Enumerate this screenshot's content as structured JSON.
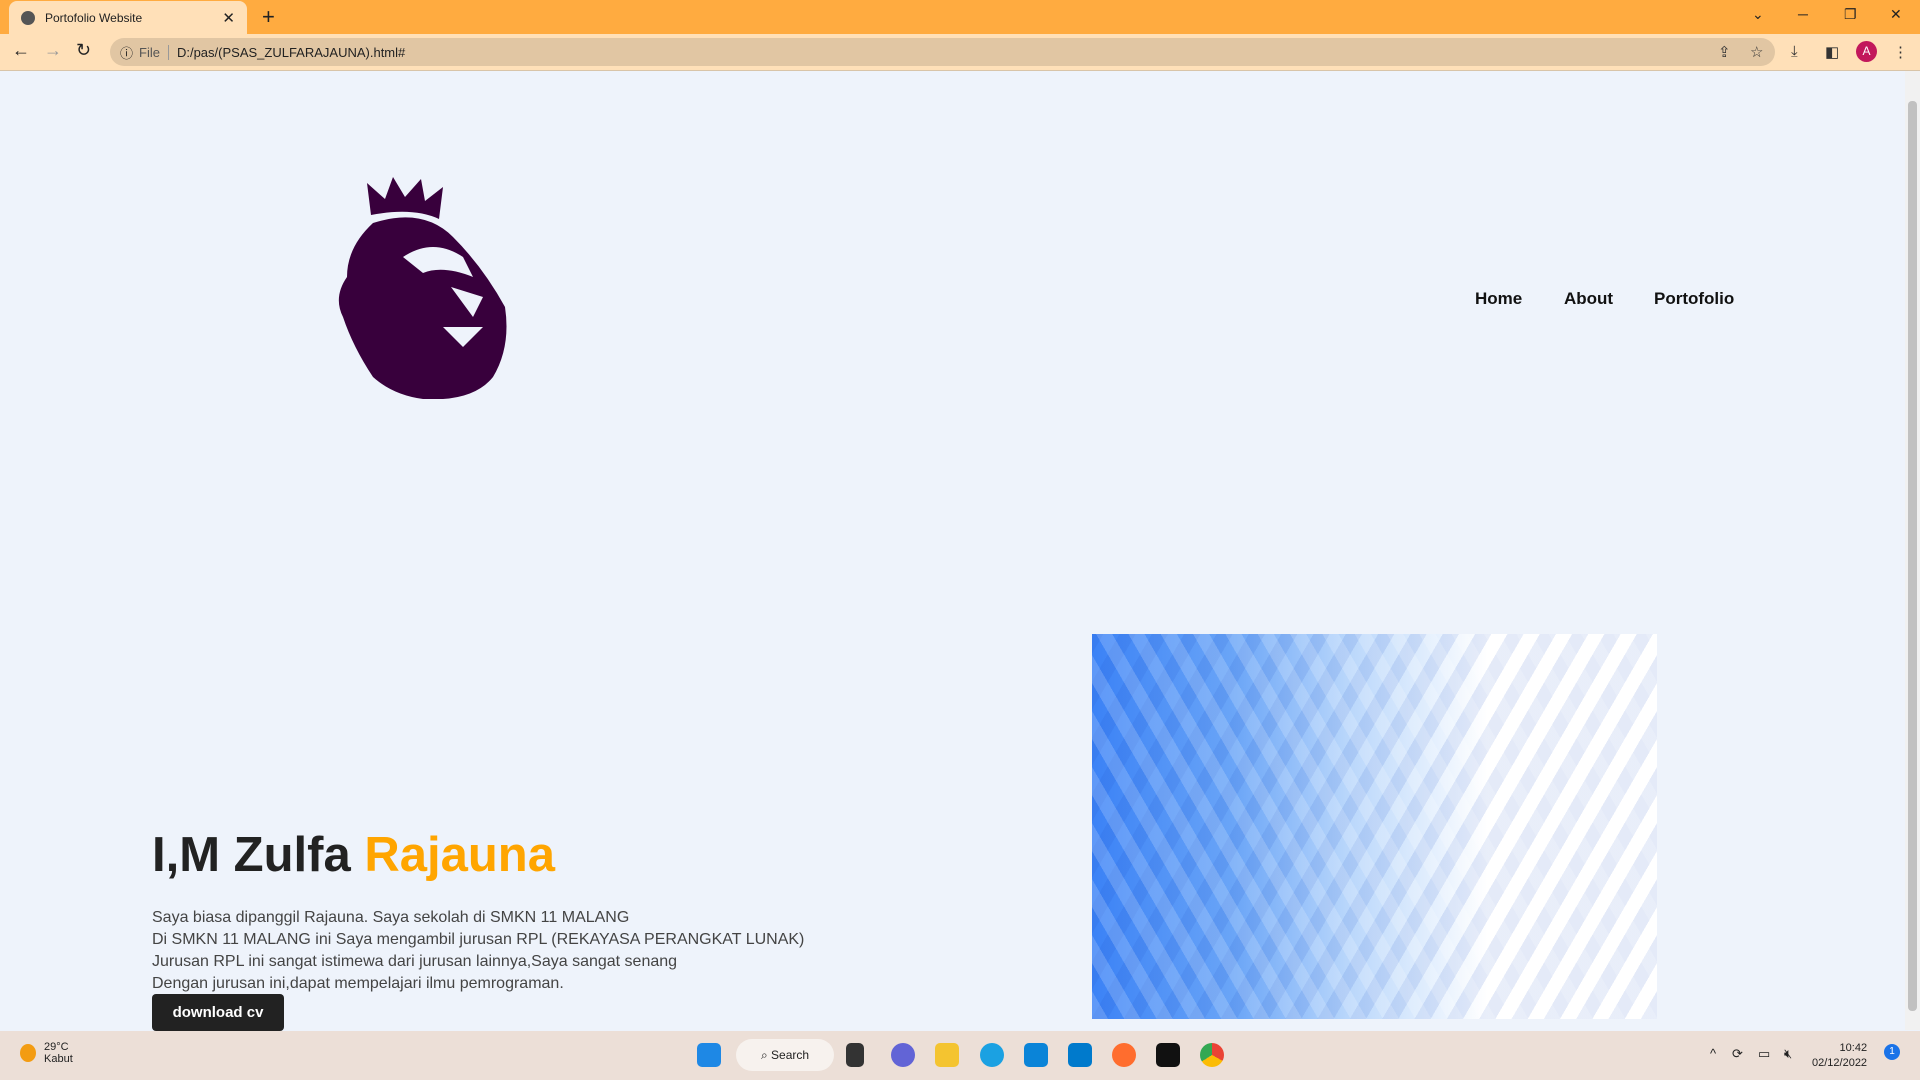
{
  "browser": {
    "tab_title": "Portofolio Website",
    "url_scheme": "File",
    "url": "D:/pas/(PSAS_ZULFARAJAUNA).html#",
    "profile_initial": "A"
  },
  "nav": {
    "items": [
      "Home",
      "About",
      "Portofolio"
    ]
  },
  "hero": {
    "name_first": "I,M Zulfa",
    "name_accent": "Rajauna",
    "lines": [
      "Saya biasa dipanggil Rajauna. Saya sekolah di SMKN 11 MALANG",
      "Di SMKN 11 MALANG ini Saya mengambil jurusan RPL (REKAYASA PERANGKAT LUNAK)",
      "Jurusan RPL ini sangat istimewa dari jurusan lainnya,Saya sangat senang",
      "Dengan jurusan ini,dapat mempelajari ilmu pemrograman."
    ],
    "button": "download cv"
  },
  "colors": {
    "accent": "#ffa500",
    "logo": "#38003c",
    "tabbar": "#ffab40"
  },
  "taskbar": {
    "weather_temp": "29°C",
    "weather_desc": "Kabut",
    "weather_badge": "1",
    "search": "Search",
    "time": "10:42",
    "date": "02/12/2022",
    "notif": "1"
  }
}
